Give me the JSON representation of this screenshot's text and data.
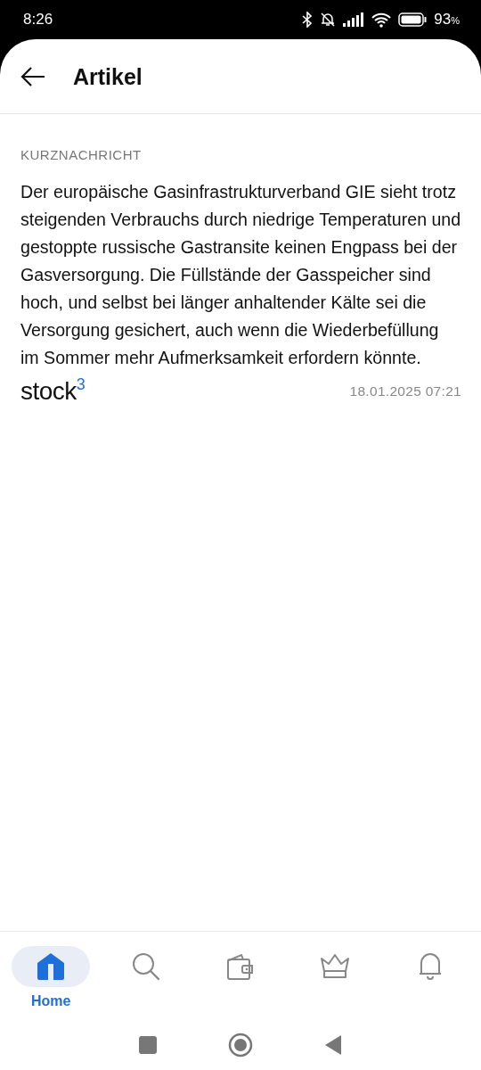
{
  "status_bar": {
    "time": "8:26",
    "battery": "93",
    "battery_unit": "%"
  },
  "header": {
    "title": "Artikel"
  },
  "article": {
    "category": "KURZNACHRICHT",
    "body": "Der europäische Gasinfrastrukturverband GIE sieht trotz steigenden Verbrauchs durch niedrige Temperaturen und gestoppte russische Gastransite keinen Engpass bei der Gasversorgung. Die Füllstände der Gasspeicher sind hoch, und selbst bei länger anhaltender Kälte sei die Versorgung gesichert, auch wenn die Wiederbefüllung im Sommer mehr Aufmerksamkeit erfordern könnte.",
    "source": "stock$^{3}$",
    "date": "18.01.2025 07:21"
  },
  "bottom_nav": [
    {
      "kind": "home",
      "label": "Home",
      "selected": true
    },
    {
      "kind": "search",
      "selected": false
    },
    {
      "kind": "wallet",
      "selected": false
    },
    {
      "kind": "crown",
      "selected": false
    },
    {
      "kind": "bell",
      "selected": false
    }
  ]
}
